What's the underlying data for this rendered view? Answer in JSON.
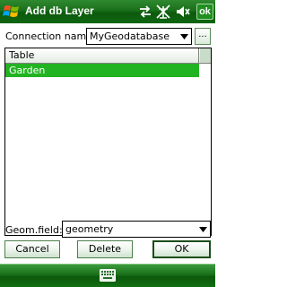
{
  "titlebar": {
    "title": "Add db Layer",
    "ok_label": "ok",
    "icons": [
      "start-flag-icon",
      "connectivity-icon",
      "signal-off-icon",
      "volume-icon"
    ]
  },
  "connection": {
    "label": "Connection name:",
    "value": "MyGeodatabase",
    "browse_label": "..."
  },
  "table": {
    "columns": [
      "Table"
    ],
    "rows": [
      {
        "name": "Garden",
        "selected": true
      }
    ]
  },
  "geometry": {
    "label": "Geom.field:",
    "value": "geometry"
  },
  "buttons": {
    "cancel": "Cancel",
    "delete": "Delete",
    "ok": "OK"
  },
  "softbar": {
    "icon": "keyboard-icon"
  },
  "colors": {
    "titlebar": "#1a6f1a",
    "selection": "#22b322",
    "button_border": "#4d7f4d"
  }
}
